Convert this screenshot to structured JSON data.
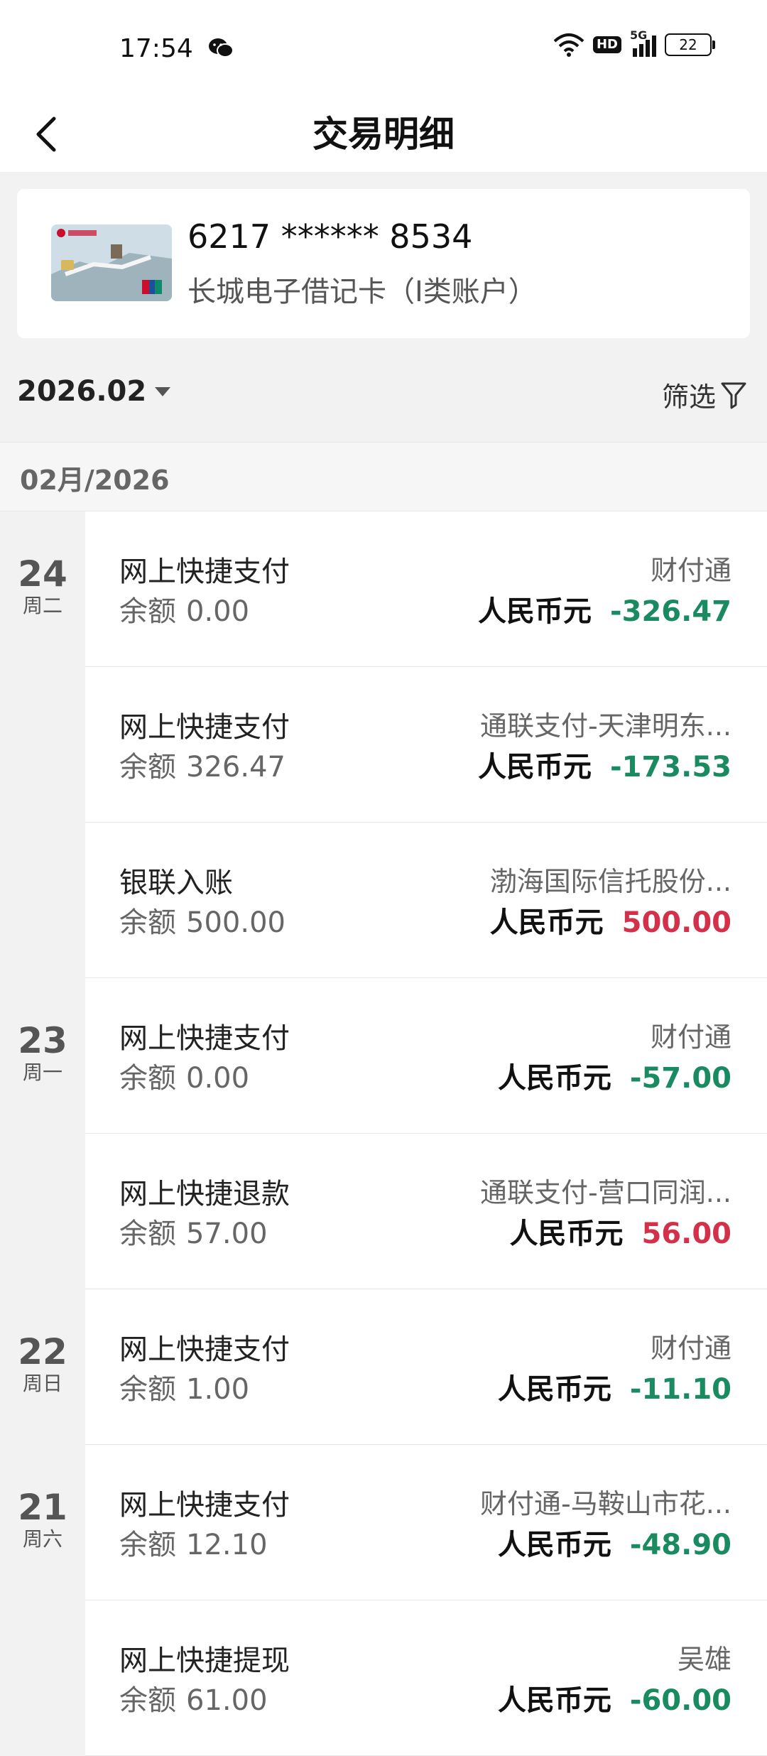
{
  "status_bar": {
    "time": "17:54",
    "wechat_icon": "wechat-icon",
    "wifi_icon": "wifi-icon",
    "hd_label": "HD",
    "network_label": "5G",
    "battery_level": "22"
  },
  "navbar": {
    "back_icon": "chevron-left-icon",
    "title": "交易明细"
  },
  "card": {
    "number": "6217 ****** 8534",
    "name": "长城电子借记卡（I类账户）"
  },
  "month_filter": {
    "month": "2026.02",
    "filter_label": "筛选",
    "filter_icon": "funnel-icon"
  },
  "section": {
    "header": "02月/2026"
  },
  "transactions": [
    {
      "day": "24",
      "weekday": "周二",
      "type": "网上快捷支付",
      "balance_label": "余额",
      "balance": "0.00",
      "merchant": "财付通",
      "currency": "人民币元",
      "amount": "-326.47",
      "direction": "out"
    },
    {
      "day": "",
      "weekday": "",
      "type": "网上快捷支付",
      "balance_label": "余额",
      "balance": "326.47",
      "merchant": "通联支付-天津明东...",
      "currency": "人民币元",
      "amount": "-173.53",
      "direction": "out"
    },
    {
      "day": "",
      "weekday": "",
      "type": "银联入账",
      "balance_label": "余额",
      "balance": "500.00",
      "merchant": "渤海国际信托股份...",
      "currency": "人民币元",
      "amount": "500.00",
      "direction": "in"
    },
    {
      "day": "23",
      "weekday": "周一",
      "type": "网上快捷支付",
      "balance_label": "余额",
      "balance": "0.00",
      "merchant": "财付通",
      "currency": "人民币元",
      "amount": "-57.00",
      "direction": "out"
    },
    {
      "day": "",
      "weekday": "",
      "type": "网上快捷退款",
      "balance_label": "余额",
      "balance": "57.00",
      "merchant": "通联支付-营口同润...",
      "currency": "人民币元",
      "amount": "56.00",
      "direction": "in"
    },
    {
      "day": "22",
      "weekday": "周日",
      "type": "网上快捷支付",
      "balance_label": "余额",
      "balance": "1.00",
      "merchant": "财付通",
      "currency": "人民币元",
      "amount": "-11.10",
      "direction": "out"
    },
    {
      "day": "21",
      "weekday": "周六",
      "type": "网上快捷支付",
      "balance_label": "余额",
      "balance": "12.10",
      "merchant": "财付通-马鞍山市花...",
      "currency": "人民币元",
      "amount": "-48.90",
      "direction": "out"
    },
    {
      "day": "",
      "weekday": "",
      "type": "网上快捷提现",
      "balance_label": "余额",
      "balance": "61.00",
      "merchant": "吴雄",
      "currency": "人民币元",
      "amount": "-60.00",
      "direction": "out"
    }
  ],
  "colors": {
    "debit": "#1a8a60",
    "credit": "#d33049",
    "page_bg": "#f2f2f2"
  }
}
